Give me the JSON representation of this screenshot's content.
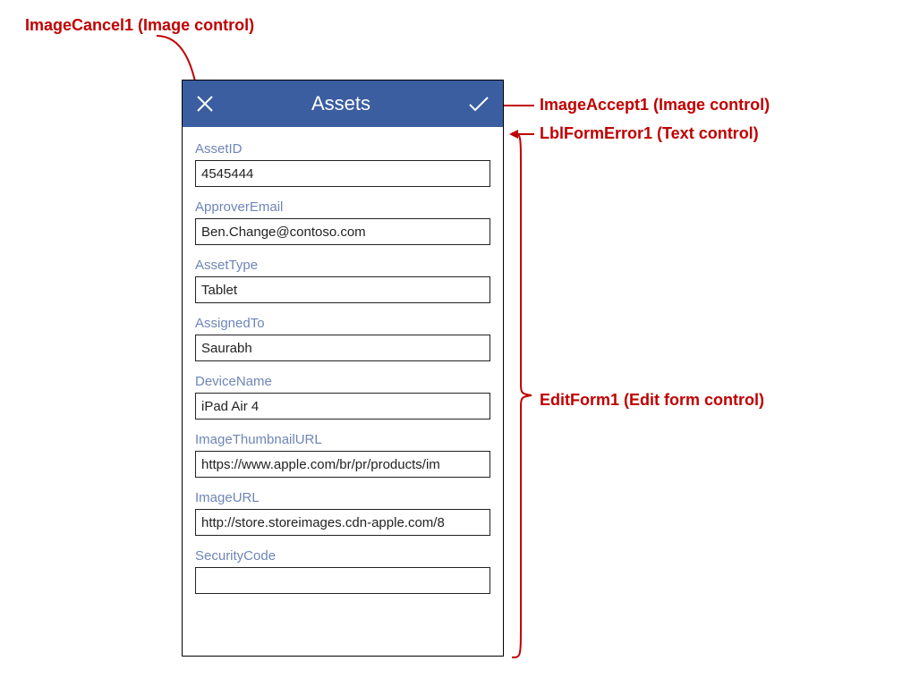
{
  "callouts": {
    "cancel": "ImageCancel1 (Image control)",
    "accept": "ImageAccept1 (Image control)",
    "error": "LblFormError1 (Text control)",
    "form": "EditForm1 (Edit form control)"
  },
  "screen": {
    "title": "Assets",
    "cards": [
      {
        "label": "AssetID",
        "value": "4545444"
      },
      {
        "label": "ApproverEmail",
        "value": "Ben.Change@contoso.com"
      },
      {
        "label": "AssetType",
        "value": "Tablet"
      },
      {
        "label": "AssignedTo",
        "value": "Saurabh"
      },
      {
        "label": "DeviceName",
        "value": "iPad Air 4"
      },
      {
        "label": "ImageThumbnailURL",
        "value": "https://www.apple.com/br/pr/products/im"
      },
      {
        "label": "ImageURL",
        "value": "http://store.storeimages.cdn-apple.com/8"
      },
      {
        "label": "SecurityCode",
        "value": ""
      }
    ]
  }
}
